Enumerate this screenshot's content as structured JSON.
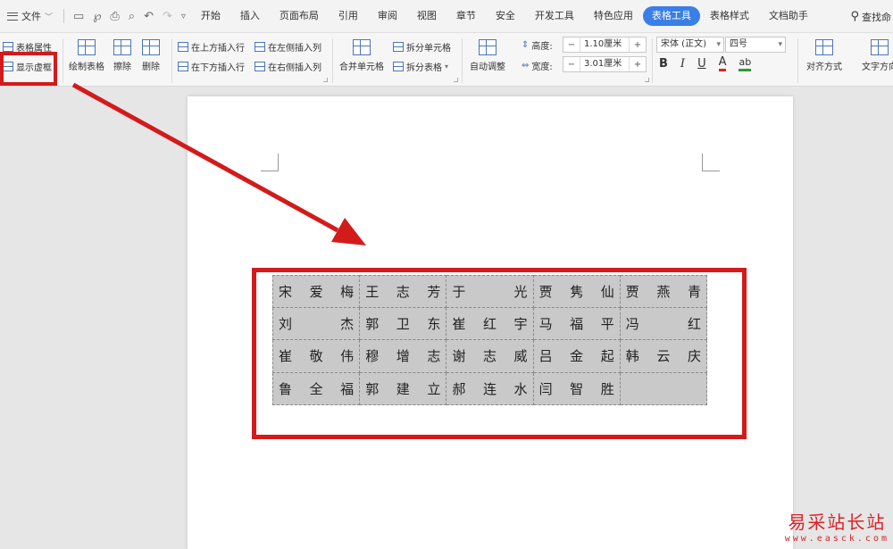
{
  "menubar": {
    "file_label": "文件",
    "tabs": [
      "开始",
      "插入",
      "页面布局",
      "引用",
      "审阅",
      "视图",
      "章节",
      "安全",
      "开发工具",
      "特色应用",
      "表格工具",
      "表格样式",
      "文档助手"
    ],
    "active_tab": "表格工具",
    "search_label": "查找命"
  },
  "ribbon": {
    "table_props": "表格属性",
    "show_gridlines": "显示虚框",
    "draw_table": "绘制表格",
    "erase": "擦除",
    "delete": "删除",
    "insert_above": "在上方插入行",
    "insert_below": "在下方插入行",
    "insert_left": "在左侧插入列",
    "insert_right": "在右侧插入列",
    "merge_cells": "合并单元格",
    "split_cells": "拆分单元格",
    "split_table": "拆分表格",
    "autofit": "自动调整",
    "height_label": "高度:",
    "height_value": "1.10厘米",
    "width_label": "宽度:",
    "width_value": "3.01厘米",
    "font_name": "宋体 (正文)",
    "font_size": "四号",
    "bold": "B",
    "italic": "I",
    "underline": "U",
    "font_color": "A",
    "highlight": "ab",
    "align": "对齐方式",
    "text_direction": "文字方向"
  },
  "table": {
    "rows": [
      [
        [
          "宋",
          "爱",
          "梅"
        ],
        [
          "王",
          "志",
          "芳"
        ],
        [
          "于",
          "",
          "光"
        ],
        [
          "贾",
          "隽",
          "仙"
        ],
        [
          "贾",
          "燕",
          "青"
        ]
      ],
      [
        [
          "刘",
          "",
          "杰"
        ],
        [
          "郭",
          "卫",
          "东"
        ],
        [
          "崔",
          "红",
          "宇"
        ],
        [
          "马",
          "福",
          "平"
        ],
        [
          "冯",
          "",
          "红"
        ]
      ],
      [
        [
          "崔",
          "敬",
          "伟"
        ],
        [
          "穆",
          "增",
          "志"
        ],
        [
          "谢",
          "志",
          "威"
        ],
        [
          "吕",
          "金",
          "起"
        ],
        [
          "韩",
          "云",
          "庆"
        ]
      ],
      [
        [
          "鲁",
          "全",
          "福"
        ],
        [
          "郭",
          "建",
          "立"
        ],
        [
          "郝",
          "连",
          "水"
        ],
        [
          "闫",
          "智",
          "胜"
        ],
        [
          "",
          "",
          ""
        ]
      ]
    ]
  },
  "watermark": {
    "title": "易采站长站",
    "url": "www.easck.com"
  },
  "colors": {
    "highlight_red": "#d31b1b",
    "active_tab_blue": "#3a7ee8",
    "table_fill": "#c9c9c9"
  }
}
